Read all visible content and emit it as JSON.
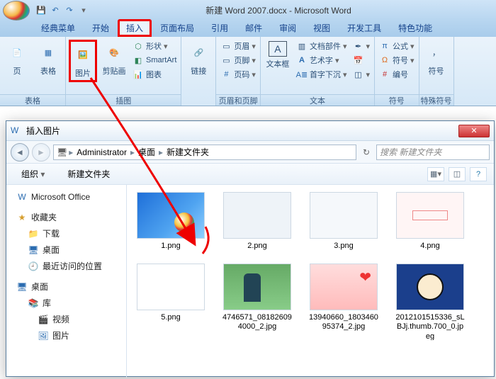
{
  "titlebar": {
    "document_title": "新建 Word 2007.docx - Microsoft Word"
  },
  "tabs": {
    "classic": "经典菜单",
    "home": "开始",
    "insert": "插入",
    "layout": "页面布局",
    "ref": "引用",
    "mail": "邮件",
    "review": "审阅",
    "view": "视图",
    "dev": "开发工具",
    "special": "特色功能"
  },
  "ribbon": {
    "page_group": "表格",
    "page_btn": "页",
    "table_btn": "表格",
    "illus_group": "插图",
    "picture_btn": "图片",
    "clipart_btn": "剪贴画",
    "shapes": "形状",
    "smartart": "SmartArt",
    "chart": "图表",
    "links_group": "链接",
    "links_btn": "链接",
    "hf_group": "页眉和页脚",
    "header": "页眉",
    "footer": "页脚",
    "pagenum": "页码",
    "text_group": "文本",
    "textbox": "文本框",
    "quickparts": "文档部件",
    "wordart": "艺术字",
    "dropcap": "首字下沉",
    "sym_group": "符号",
    "equation": "公式",
    "symbol": "符号",
    "number": "编号",
    "special_group": "特殊符号",
    "special_btn": "符号"
  },
  "dialog": {
    "title": "插入图片",
    "breadcrumb": [
      "Administrator",
      "桌面",
      "新建文件夹"
    ],
    "search_placeholder": "搜索 新建文件夹",
    "organize": "组织",
    "newfolder": "新建文件夹"
  },
  "sidebar": {
    "office": "Microsoft Office",
    "favorites": "收藏夹",
    "downloads": "下载",
    "desktop": "桌面",
    "recent": "最近访问的位置",
    "desktop2": "桌面",
    "library": "库",
    "videos": "视频",
    "pictures": "图片"
  },
  "files": [
    {
      "name": "1.png",
      "th": "th1"
    },
    {
      "name": "2.png",
      "th": "th2"
    },
    {
      "name": "3.png",
      "th": "th3"
    },
    {
      "name": "4.png",
      "th": "th4"
    },
    {
      "name": "5.png",
      "th": "th5"
    },
    {
      "name": "4746571_081826094000_2.jpg",
      "th": "th6"
    },
    {
      "name": "13940660_180346095374_2.jpg",
      "th": "th7"
    },
    {
      "name": "2012101515336_sLBJj.thumb.700_0.jpeg",
      "th": "th8"
    }
  ]
}
